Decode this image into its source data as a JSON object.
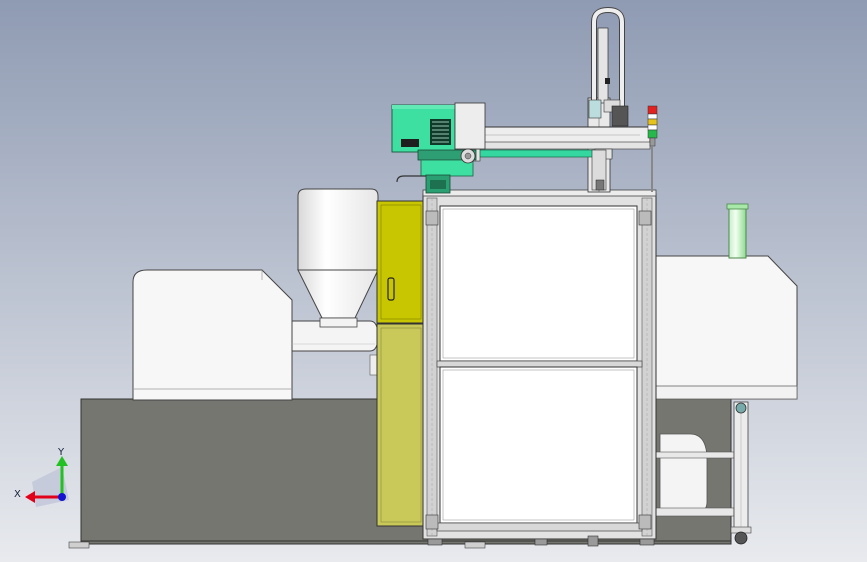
{
  "triad": {
    "x_label": "X",
    "y_label": "Y"
  },
  "colors": {
    "bg_top": "#8f9bb3",
    "bg_bottom": "#e8eaee",
    "base": "#74766f",
    "panel_white": "#f7f7f7",
    "yellow_door": "#c8c600",
    "yellow_door_lower": "#c9c95a",
    "robot_green": "#3ee0a2",
    "tube_green": "#9be39b",
    "axis_x": "#e0001a",
    "axis_y": "#22c022",
    "axis_z": "#1414d0"
  }
}
